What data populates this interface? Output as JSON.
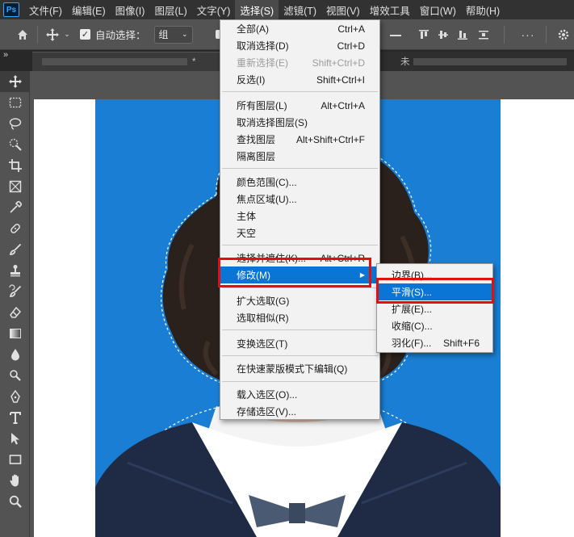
{
  "app": {
    "logo": "Ps"
  },
  "menubar": {
    "items": [
      {
        "label": "文件(F)"
      },
      {
        "label": "编辑(E)"
      },
      {
        "label": "图像(I)"
      },
      {
        "label": "图层(L)"
      },
      {
        "label": "文字(Y)"
      },
      {
        "label": "选择(S)",
        "active": true
      },
      {
        "label": "滤镜(T)"
      },
      {
        "label": "视图(V)"
      },
      {
        "label": "增效工具"
      },
      {
        "label": "窗口(W)"
      },
      {
        "label": "帮助(H)"
      }
    ]
  },
  "options": {
    "auto_select_label": "自动选择：",
    "auto_select_checked": true,
    "group_value": "组",
    "more": "···"
  },
  "tabs": {
    "tab1_suffix": "*",
    "tab2_prefix": "未"
  },
  "select_menu": {
    "items": [
      {
        "label": "全部(A)",
        "shortcut": "Ctrl+A"
      },
      {
        "label": "取消选择(D)",
        "shortcut": "Ctrl+D"
      },
      {
        "label": "重新选择(E)",
        "shortcut": "Shift+Ctrl+D",
        "disabled": true
      },
      {
        "label": "反选(I)",
        "shortcut": "Shift+Ctrl+I"
      },
      {
        "label": "所有图层(L)",
        "shortcut": "Alt+Ctrl+A"
      },
      {
        "label": "取消选择图层(S)",
        "shortcut": ""
      },
      {
        "label": "查找图层",
        "shortcut": "Alt+Shift+Ctrl+F"
      },
      {
        "label": "隔离图层",
        "shortcut": ""
      },
      {
        "label": "颜色范围(C)...",
        "shortcut": ""
      },
      {
        "label": "焦点区域(U)...",
        "shortcut": ""
      },
      {
        "label": "主体",
        "shortcut": ""
      },
      {
        "label": "天空",
        "shortcut": ""
      },
      {
        "label": "选择并遮住(K)...",
        "shortcut": "Alt+Ctrl+R"
      },
      {
        "label": "修改(M)",
        "shortcut": "",
        "submenu": true,
        "highlight": true
      },
      {
        "label": "扩大选取(G)",
        "shortcut": ""
      },
      {
        "label": "选取相似(R)",
        "shortcut": ""
      },
      {
        "label": "变换选区(T)",
        "shortcut": ""
      },
      {
        "label": "在快速蒙版模式下编辑(Q)",
        "shortcut": ""
      },
      {
        "label": "载入选区(O)...",
        "shortcut": ""
      },
      {
        "label": "存储选区(V)...",
        "shortcut": ""
      }
    ]
  },
  "modify_submenu": {
    "items": [
      {
        "label": "边界(B)...",
        "shortcut": ""
      },
      {
        "label": "平滑(S)...",
        "shortcut": "",
        "highlight": true
      },
      {
        "label": "扩展(E)...",
        "shortcut": ""
      },
      {
        "label": "收缩(C)...",
        "shortcut": ""
      },
      {
        "label": "羽化(F)...",
        "shortcut": "Shift+F6"
      }
    ]
  },
  "colors": {
    "menu_highlight": "#0b75d6",
    "photo_background": "#1a7fd4",
    "annotation": "#e01010"
  }
}
